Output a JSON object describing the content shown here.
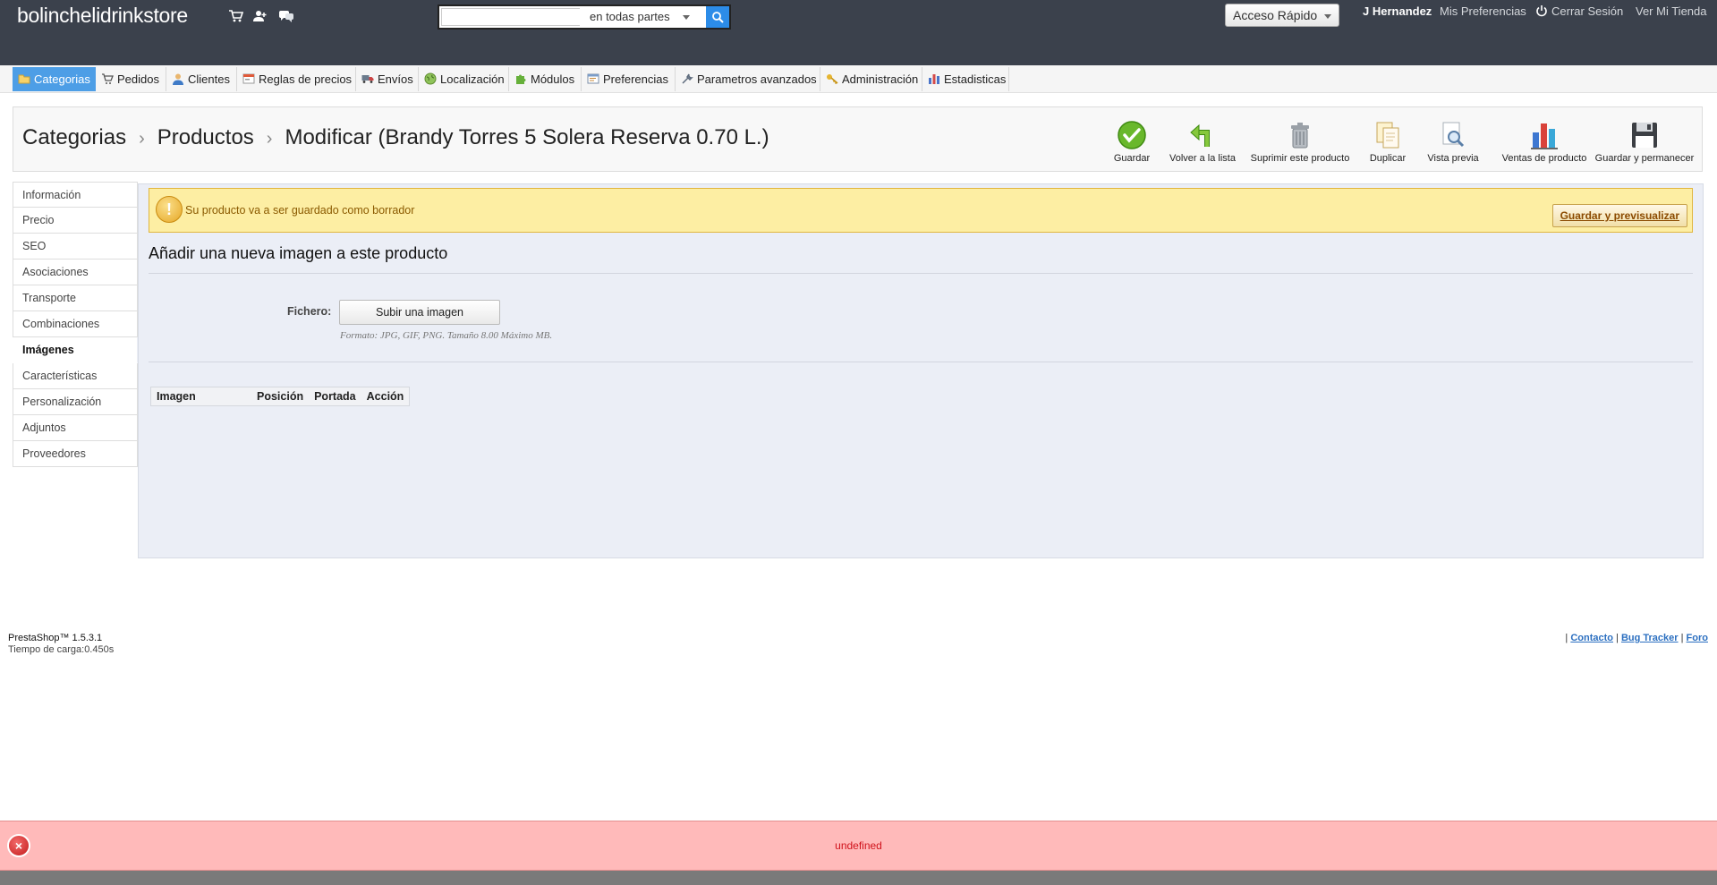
{
  "header": {
    "shop_name": "bolinchelidrinkstore",
    "icons": [
      "cart-icon",
      "customers-icon",
      "messages-icon"
    ],
    "search": {
      "value": "",
      "placeholder": "",
      "scope": "en todas partes"
    },
    "quick_access": "Acceso Rápido",
    "employee": "J Hernandez",
    "preferences": "Mis Preferencias",
    "logout": "Cerrar Sesión",
    "view_shop": "Ver Mi Tienda"
  },
  "menu": {
    "tabs": [
      {
        "label": "Categorias",
        "icon": "folder-icon"
      },
      {
        "label": "Pedidos",
        "icon": "cart-icon"
      },
      {
        "label": "Clientes",
        "icon": "user-icon"
      },
      {
        "label": "Reglas de precios",
        "icon": "price-rules-icon"
      },
      {
        "label": "Envíos",
        "icon": "truck-icon"
      },
      {
        "label": "Localización",
        "icon": "globe-icon"
      },
      {
        "label": "Módulos",
        "icon": "puzzle-icon"
      },
      {
        "label": "Preferencias",
        "icon": "preferences-icon"
      },
      {
        "label": "Parametros avanzados",
        "icon": "wrench-icon"
      },
      {
        "label": "Administración",
        "icon": "key-icon"
      },
      {
        "label": "Estadisticas",
        "icon": "stats-icon"
      }
    ],
    "active_index": 0
  },
  "toolbar": {
    "breadcrumb": [
      "Categorias",
      "Productos",
      "Modificar (Brandy Torres 5 Solera Reserva 0.70 L.)"
    ],
    "separator": "›",
    "buttons": [
      {
        "label": "Guardar",
        "icon": "save-check-icon"
      },
      {
        "label": "Volver a la lista",
        "icon": "back-arrow-icon"
      },
      {
        "label": "Suprimir este producto",
        "icon": "trash-icon"
      },
      {
        "label": "Duplicar",
        "icon": "duplicate-icon"
      },
      {
        "label": "Vista previa",
        "icon": "preview-icon"
      },
      {
        "label": "Ventas de producto",
        "icon": "sales-chart-icon"
      },
      {
        "label": "Guardar y permanecer",
        "icon": "floppy-icon"
      }
    ]
  },
  "sidebar": {
    "tabs": [
      "Información",
      "Precio",
      "SEO",
      "Asociaciones",
      "Transporte",
      "Combinaciones",
      "Imágenes",
      "Características",
      "Personalización",
      "Adjuntos",
      "Proveedores"
    ],
    "selected_index": 6
  },
  "main": {
    "warning": {
      "icon_glyph": "!",
      "text": "Su producto va a ser guardado como borrador",
      "button": "Guardar y previsualizar"
    },
    "section_title": "Añadir una nueva imagen a este producto",
    "file_label": "Fichero:",
    "upload_button": "Subir una imagen",
    "format_hint": "Formato: JPG, GIF, PNG. Tamaño 8.00 Máximo MB.",
    "table": {
      "headers": [
        "Imagen",
        "Posición",
        "Portada",
        "Acción"
      ]
    }
  },
  "footer": {
    "version": "PrestaShop™ 1.5.3.1",
    "load_time": "Tiempo de carga:0.450s",
    "separator": "|",
    "links": [
      "Contacto",
      "Bug Tracker",
      "Foro"
    ]
  },
  "error": {
    "icon_glyph": "×",
    "message": "undefined"
  },
  "colors": {
    "header_bg": "#3b414c",
    "active_tab": "#4d9ee6",
    "warning_bg": "#fdeea3",
    "panel_bg": "#ebeef6",
    "error_bg": "#ffbaba",
    "error_text": "#d0121b",
    "link": "#2b6fc0"
  }
}
